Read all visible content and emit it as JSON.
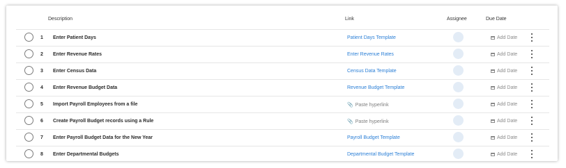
{
  "table": {
    "headers": {
      "description": "Description",
      "link": "Link",
      "assignee": "Assignee",
      "due_date": "Due Date"
    },
    "rows": [
      {
        "num": "1",
        "description": "Enter Patient Days",
        "link": "Patient Days Template",
        "link_type": "template",
        "due": "Add Date"
      },
      {
        "num": "2",
        "description": "Enter Revenue Rates",
        "link": "Enter Revenue Rates",
        "link_type": "template",
        "due": "Add Date"
      },
      {
        "num": "3",
        "description": "Enter Census Data",
        "link": "Census Data Template",
        "link_type": "template",
        "due": "Add Date"
      },
      {
        "num": "4",
        "description": "Enter Revenue Budget Data",
        "link": "Revenue Budget Template",
        "link_type": "template",
        "due": "Add Date"
      },
      {
        "num": "5",
        "description": "Import Payroll Employees from a file",
        "link": "Paste hyperlink",
        "link_type": "placeholder",
        "due": "Add Date"
      },
      {
        "num": "6",
        "description": "Create Payroll Budget records using a Rule",
        "link": "Paste hyperlink",
        "link_type": "placeholder",
        "due": "Add Date"
      },
      {
        "num": "7",
        "description": "Enter Payroll Budget Data for the New Year",
        "link": "Payroll Budget Template",
        "link_type": "template",
        "due": "Add Date"
      },
      {
        "num": "8",
        "description": "Enter Departmental Budgets",
        "link": "Departmental Budget Template",
        "link_type": "template",
        "due": "Add Date"
      }
    ]
  },
  "icons": {
    "status": "circle-checkbox-icon",
    "paste_link": "paperclip-icon",
    "due_date": "calendar-icon",
    "row_menu": "more-vertical-icon",
    "assignee": "avatar-placeholder-icon"
  },
  "colors": {
    "link": "#2b7fd6",
    "placeholder_text": "#7e7e7e",
    "assignee_avatar": "#e3ecf6"
  }
}
